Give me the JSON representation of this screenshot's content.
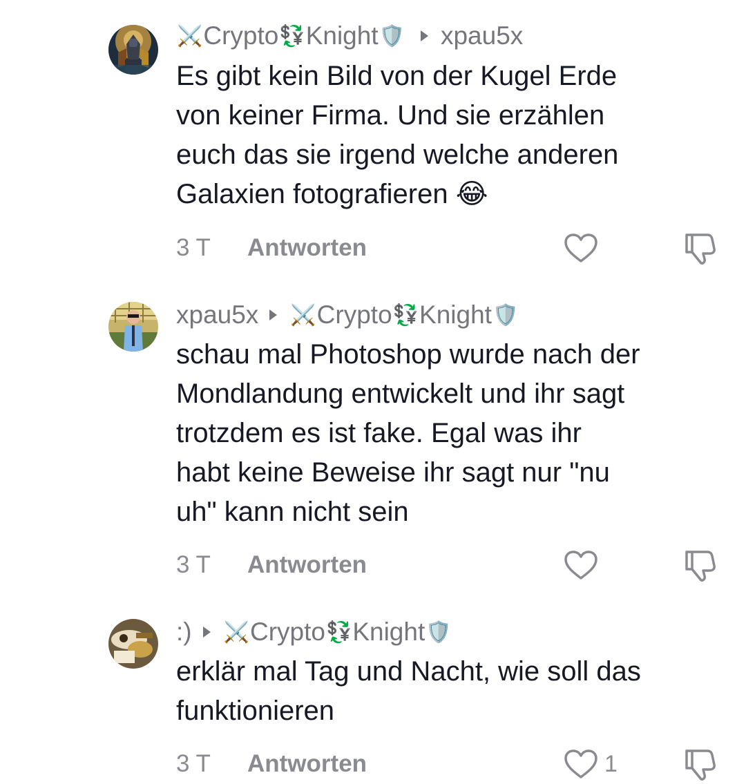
{
  "comments": [
    {
      "author": "Crypto",
      "author_suffix": "Knight",
      "reply_to": "xpau5x",
      "reply_to_suffix": "",
      "reply_to_deco": false,
      "author_deco": true,
      "text": "Es gibt kein Bild von der Kugel Erde\nvon keiner Firma. Und sie erzählen\neuch das sie irgend welche anderen\nGalaxien fotografieren 😂",
      "time": "3 T",
      "reply_label": "Antworten",
      "likes": ""
    },
    {
      "author": "xpau5x",
      "author_suffix": "",
      "author_deco": false,
      "reply_to": "Crypto",
      "reply_to_suffix": "Knight",
      "reply_to_deco": true,
      "text": "schau mal Photoshop wurde nach der\nMondlandung entwickelt und ihr sagt\ntrotzdem es ist fake. Egal was ihr\nhabt keine Beweise ihr sagt nur \"nu\nuh\" kann nicht sein",
      "time": "3 T",
      "reply_label": "Antworten",
      "likes": ""
    },
    {
      "author": ":)",
      "author_suffix": "",
      "author_deco": false,
      "reply_to": "Crypto",
      "reply_to_suffix": "Knight",
      "reply_to_deco": true,
      "text": "erklär mal Tag und Nacht, wie soll das\nfunktionieren",
      "time": "3 T",
      "reply_label": "Antworten",
      "likes": "1"
    }
  ],
  "icons": {
    "like": "heart-outline-icon",
    "dislike": "thumbs-down-outline-icon",
    "reply_arrow": "triangle-right-icon",
    "deco_before": "crossed-swords-icon",
    "deco_middle": "currency-exchange-icon",
    "deco_after": "shield-icon"
  },
  "colors": {
    "text": "#161823",
    "secondary": "#75767c",
    "meta": "#8a8b91",
    "background": "#ffffff"
  }
}
